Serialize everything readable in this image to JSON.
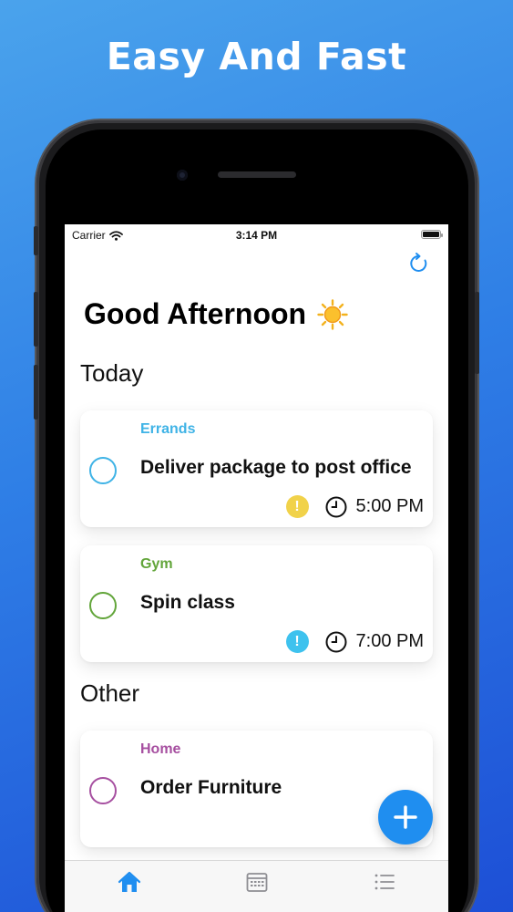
{
  "headline": "Easy And Fast",
  "status_bar": {
    "carrier": "Carrier",
    "time": "3:14 PM"
  },
  "greeting": "Good Afternoon",
  "icons": {
    "weather": "sun-icon",
    "refresh": "refresh-icon",
    "add": "plus-icon",
    "tabs": [
      "home-icon",
      "calendar-icon",
      "list-icon"
    ]
  },
  "sections": {
    "today": "Today",
    "other": "Other"
  },
  "tasks": [
    {
      "category": "Errands",
      "category_color": "#3fb3e6",
      "title": "Deliver package to post office",
      "circle_color": "#3fb3e6",
      "priority_color": "#f1d24a",
      "priority_symbol": "!",
      "time": "5:00 PM"
    },
    {
      "category": "Gym",
      "category_color": "#62a53a",
      "title": "Spin class",
      "circle_color": "#62a53a",
      "priority_color": "#3ec2ee",
      "priority_symbol": "!",
      "time": "7:00 PM"
    },
    {
      "category": "Home",
      "category_color": "#a64fa0",
      "title": "Order Furniture",
      "circle_color": "#a64fa0"
    }
  ],
  "colors": {
    "accent": "#1f8ef0",
    "tab_active": "#1f8ef0",
    "tab_inactive": "#8e8e93"
  },
  "tabbar": {
    "active_index": 0
  }
}
